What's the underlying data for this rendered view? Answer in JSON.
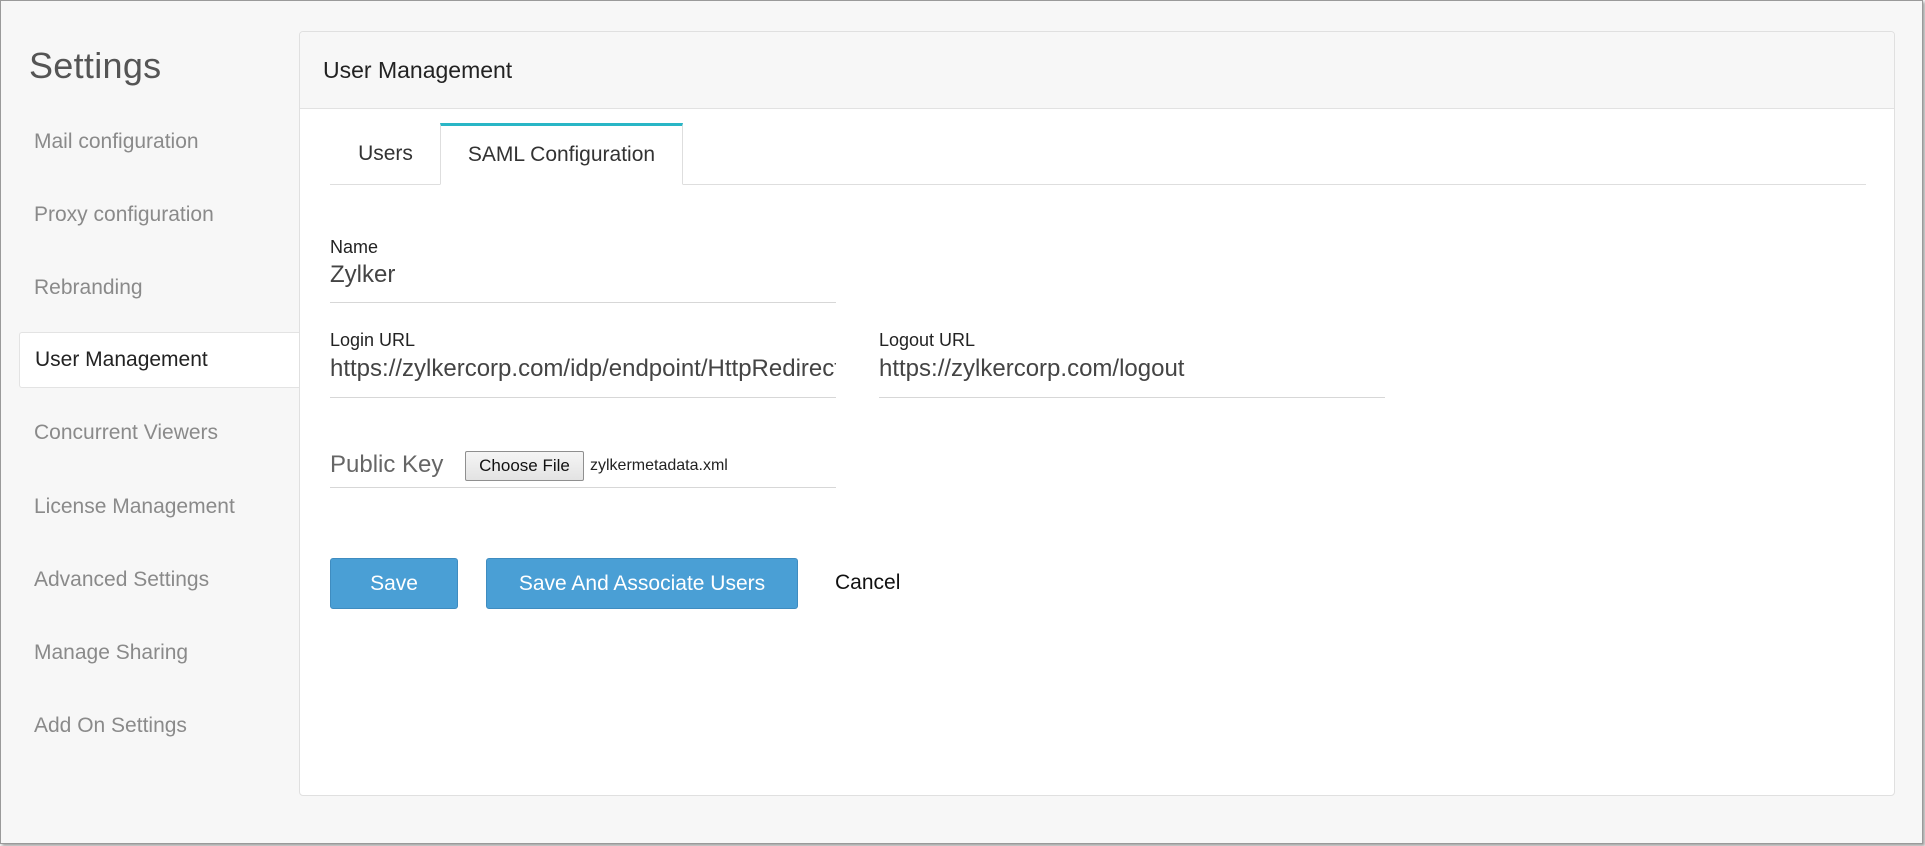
{
  "sidebar": {
    "title": "Settings",
    "items": [
      {
        "label": "Mail configuration"
      },
      {
        "label": "Proxy configuration"
      },
      {
        "label": "Rebranding"
      },
      {
        "label": "User Management"
      },
      {
        "label": "Concurrent Viewers"
      },
      {
        "label": "License Management"
      },
      {
        "label": "Advanced Settings"
      },
      {
        "label": "Manage Sharing"
      },
      {
        "label": "Add On Settings"
      }
    ],
    "active_item": "User Management"
  },
  "panel": {
    "title": "User Management",
    "tabs": [
      {
        "label": "Users"
      },
      {
        "label": "SAML Configuration"
      }
    ],
    "active_tab": "SAML Configuration"
  },
  "form": {
    "name_label": "Name",
    "name_value": "Zylker",
    "login_url_label": "Login URL",
    "login_url_value": "https://zylkercorp.com/idp/endpoint/HttpRedirect",
    "logout_url_label": "Logout URL",
    "logout_url_value": "https://zylkercorp.com/logout",
    "public_key_label": "Public Key",
    "choose_file_label": "Choose File",
    "file_name": "zylkermetadata.xml"
  },
  "actions": {
    "save_label": "Save",
    "save_associate_label": "Save And Associate Users",
    "cancel_label": "Cancel"
  },
  "colors": {
    "accent": "#4a9fd5",
    "tab_accent": "#29b6c6"
  }
}
